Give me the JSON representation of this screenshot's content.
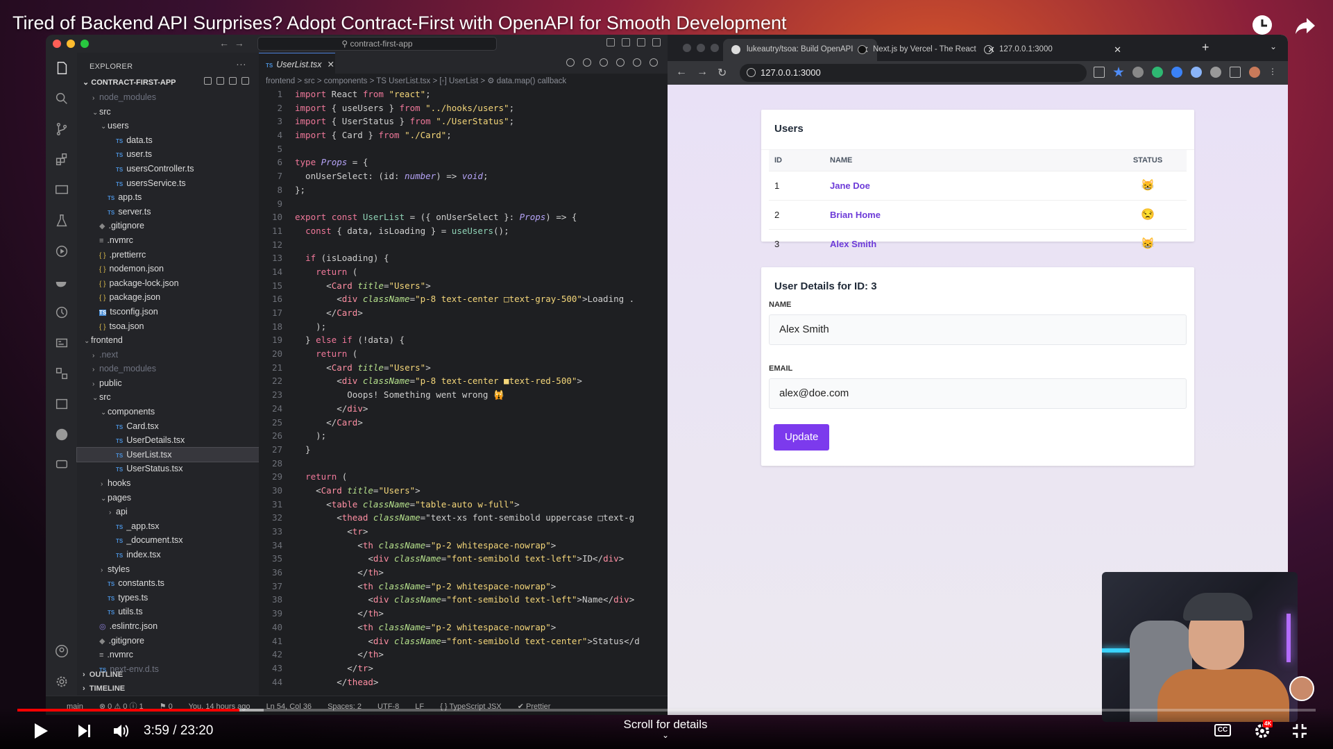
{
  "video": {
    "title": "Tired of Backend API Surprises? Adopt Contract-First with OpenAPI for Smooth Development",
    "time_current": "3:59",
    "time_total": "23:20",
    "time_display": "3:59 / 23:20",
    "progress_fraction": 0.171,
    "buffered_fraction": 0.19,
    "scroll_hint": "Scroll for details",
    "cc_label": "CC",
    "quality_badge": "4K"
  },
  "vscode": {
    "search_placeholder": "contract-first-app",
    "explorer_label": "EXPLORER",
    "project_name": "CONTRACT-FIRST-APP",
    "tree": [
      {
        "label": "node_modules",
        "indent": 1,
        "kind": "folder",
        "open": false,
        "dim": true
      },
      {
        "label": "src",
        "indent": 1,
        "kind": "folder",
        "open": true
      },
      {
        "label": "users",
        "indent": 2,
        "kind": "folder",
        "open": true
      },
      {
        "label": "data.ts",
        "indent": 3,
        "kind": "ts"
      },
      {
        "label": "user.ts",
        "indent": 3,
        "kind": "ts"
      },
      {
        "label": "usersController.ts",
        "indent": 3,
        "kind": "ts"
      },
      {
        "label": "usersService.ts",
        "indent": 3,
        "kind": "ts"
      },
      {
        "label": "app.ts",
        "indent": 2,
        "kind": "ts"
      },
      {
        "label": "server.ts",
        "indent": 2,
        "kind": "ts"
      },
      {
        "label": ".gitignore",
        "indent": 1,
        "kind": "git"
      },
      {
        "label": ".nvmrc",
        "indent": 1,
        "kind": "eq"
      },
      {
        "label": ".prettierrc",
        "indent": 1,
        "kind": "json"
      },
      {
        "label": "nodemon.json",
        "indent": 1,
        "kind": "json"
      },
      {
        "label": "package-lock.json",
        "indent": 1,
        "kind": "json"
      },
      {
        "label": "package.json",
        "indent": 1,
        "kind": "json"
      },
      {
        "label": "tsconfig.json",
        "indent": 1,
        "kind": "tsc"
      },
      {
        "label": "tsoa.json",
        "indent": 1,
        "kind": "json"
      },
      {
        "label": "frontend",
        "indent": 0,
        "kind": "folder",
        "open": true
      },
      {
        "label": ".next",
        "indent": 1,
        "kind": "folder",
        "open": false,
        "dim": true
      },
      {
        "label": "node_modules",
        "indent": 1,
        "kind": "folder",
        "open": false,
        "dim": true
      },
      {
        "label": "public",
        "indent": 1,
        "kind": "folder",
        "open": false
      },
      {
        "label": "src",
        "indent": 1,
        "kind": "folder",
        "open": true
      },
      {
        "label": "components",
        "indent": 2,
        "kind": "folder",
        "open": true
      },
      {
        "label": "Card.tsx",
        "indent": 3,
        "kind": "ts"
      },
      {
        "label": "UserDetails.tsx",
        "indent": 3,
        "kind": "ts"
      },
      {
        "label": "UserList.tsx",
        "indent": 3,
        "kind": "ts",
        "selected": true
      },
      {
        "label": "UserStatus.tsx",
        "indent": 3,
        "kind": "ts"
      },
      {
        "label": "hooks",
        "indent": 2,
        "kind": "folder",
        "open": false
      },
      {
        "label": "pages",
        "indent": 2,
        "kind": "folder",
        "open": true
      },
      {
        "label": "api",
        "indent": 3,
        "kind": "folder",
        "open": false
      },
      {
        "label": "_app.tsx",
        "indent": 3,
        "kind": "ts"
      },
      {
        "label": "_document.tsx",
        "indent": 3,
        "kind": "ts"
      },
      {
        "label": "index.tsx",
        "indent": 3,
        "kind": "ts"
      },
      {
        "label": "styles",
        "indent": 2,
        "kind": "folder",
        "open": false
      },
      {
        "label": "constants.ts",
        "indent": 2,
        "kind": "ts"
      },
      {
        "label": "types.ts",
        "indent": 2,
        "kind": "ts"
      },
      {
        "label": "utils.ts",
        "indent": 2,
        "kind": "ts"
      },
      {
        "label": ".eslintrc.json",
        "indent": 1,
        "kind": "eslint"
      },
      {
        "label": ".gitignore",
        "indent": 1,
        "kind": "git"
      },
      {
        "label": ".nvmrc",
        "indent": 1,
        "kind": "eq"
      },
      {
        "label": "next-env.d.ts",
        "indent": 1,
        "kind": "ts",
        "dim": true
      }
    ],
    "outline_label": "OUTLINE",
    "timeline_label": "TIMELINE",
    "tab_label": "UserList.tsx",
    "breadcrumb": "frontend > src > components > TS UserList.tsx > [◦] UserList > ⚙ data.map() callback",
    "code_lines": [
      "import React from \"react\";",
      "import { useUsers } from \"../hooks/users\";",
      "import { UserStatus } from \"./UserStatus\";",
      "import { Card } from \"./Card\";",
      "",
      "type Props = {",
      "  onUserSelect: (id: number) => void;",
      "};",
      "",
      "export const UserList = ({ onUserSelect }: Props) => {",
      "  const { data, isLoading } = useUsers();",
      "",
      "  if (isLoading) {",
      "    return (",
      "      <Card title=\"Users\">",
      "        <div className=\"p-8 text-center □text-gray-500\">Loading .",
      "      </Card>",
      "    );",
      "  } else if (!data) {",
      "    return (",
      "      <Card title=\"Users\">",
      "        <div className=\"p-8 text-center ■text-red-500\">",
      "          Ooops! Something went wrong 🙀",
      "        </div>",
      "      </Card>",
      "    );",
      "  }",
      "",
      "  return (",
      "    <Card title=\"Users\">",
      "      <table className=\"table-auto w-full\">",
      "        <thead className=\"text-xs font-semibold uppercase □text-g",
      "          <tr>",
      "            <th className=\"p-2 whitespace-nowrap\">",
      "              <div className=\"font-semibold text-left\">ID</div>",
      "            </th>",
      "            <th className=\"p-2 whitespace-nowrap\">",
      "              <div className=\"font-semibold text-left\">Name</div>",
      "            </th>",
      "            <th className=\"p-2 whitespace-nowrap\">",
      "              <div className=\"font-semibold text-center\">Status</d",
      "            </th>",
      "          </tr>",
      "        </thead>"
    ],
    "status": {
      "branch": "main",
      "errors": "⊗ 0 ⚠ 0 ⓘ 1",
      "ports": "⚑ 0",
      "blame": "You, 14 hours ago",
      "position": "Ln 54, Col 36",
      "spaces": "Spaces: 2",
      "encoding": "UTF-8",
      "eol": "LF",
      "language": "{ } TypeScript JSX",
      "prettier": "✔ Prettier"
    }
  },
  "browser": {
    "tabs": [
      {
        "label": "lukeautry/tsoa: Build OpenAPI",
        "active": true
      },
      {
        "label": "Next.js by Vercel - The React",
        "active": false
      },
      {
        "label": "127.0.0.1:3000",
        "active": false
      }
    ],
    "url": "127.0.0.1:3000",
    "users_card": {
      "title": "Users",
      "columns": [
        "ID",
        "NAME",
        "STATUS"
      ],
      "rows": [
        {
          "id": "1",
          "name": "Jane Doe",
          "status": "😸"
        },
        {
          "id": "2",
          "name": "Brian Home",
          "status": "😒"
        },
        {
          "id": "3",
          "name": "Alex Smith",
          "status": "😸"
        }
      ]
    },
    "details_card": {
      "title": "User Details for ID: 3",
      "name_label": "NAME",
      "name_value": "Alex Smith",
      "email_label": "EMAIL",
      "email_value": "alex@doe.com",
      "update_label": "Update"
    }
  },
  "colors": {
    "accent": "#7c3aed",
    "link": "#6d3bd8",
    "yt_red": "#ff0000"
  }
}
